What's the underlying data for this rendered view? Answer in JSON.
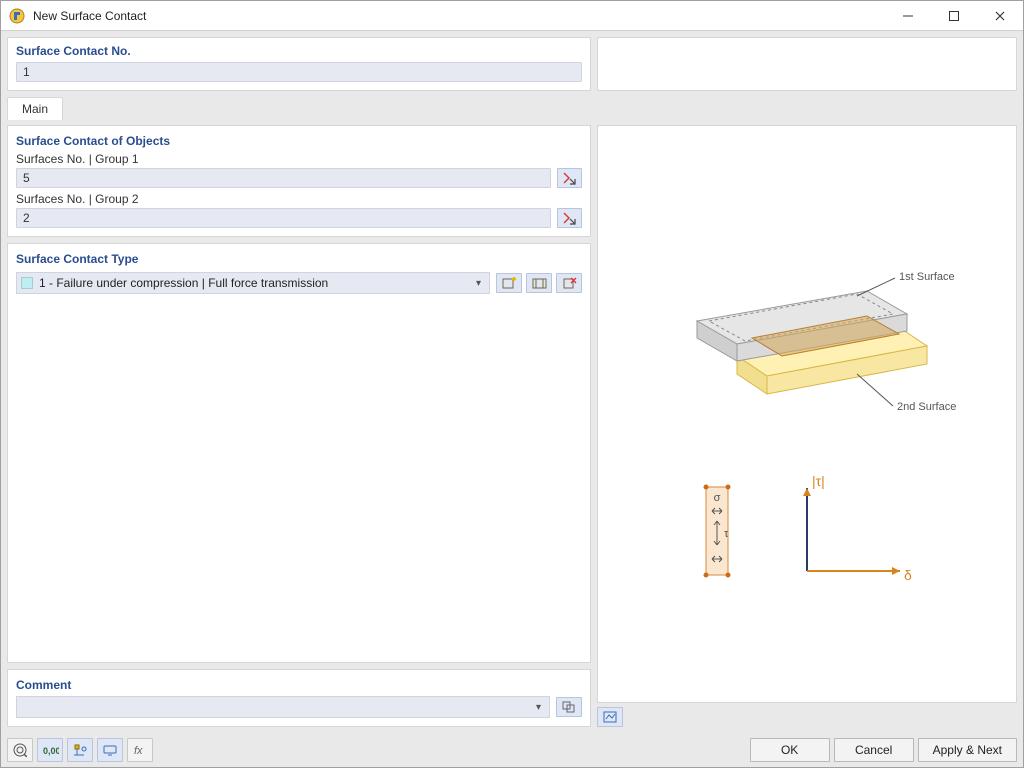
{
  "title": "New Surface Contact",
  "top": {
    "number_label": "Surface Contact No.",
    "number_value": "1"
  },
  "tabs": {
    "main": "Main"
  },
  "objects": {
    "section_title": "Surface Contact of Objects",
    "group1_label": "Surfaces No. | Group 1",
    "group1_value": "5",
    "group2_label": "Surfaces No. | Group 2",
    "group2_value": "2"
  },
  "type": {
    "section_title": "Surface Contact Type",
    "selected": "1 - Failure under compression | Full force transmission"
  },
  "comment": {
    "section_title": "Comment",
    "value": ""
  },
  "preview": {
    "surface1_label": "1st Surface",
    "surface2_label": "2nd Surface",
    "tau_label": "|τ|",
    "delta_label": "δ",
    "sigma_label": "σ",
    "tau_sym": "τ"
  },
  "buttons": {
    "ok": "OK",
    "cancel": "Cancel",
    "apply_next": "Apply & Next"
  }
}
